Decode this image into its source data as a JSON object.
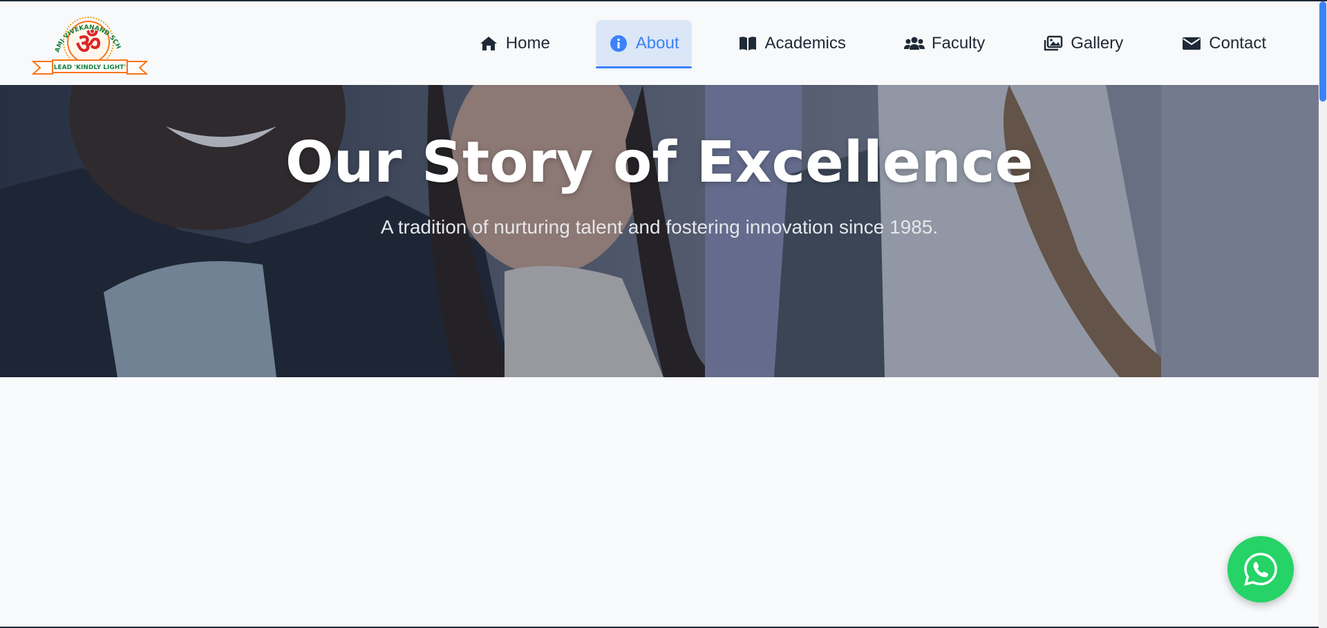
{
  "logo": {
    "school_name": "SWAMI VIVEKANAND SCHOOL",
    "motto": "LEAD 'KINDLY LIGHT'"
  },
  "nav": {
    "items": [
      {
        "label": "Home",
        "icon": "home-icon",
        "active": false
      },
      {
        "label": "About",
        "icon": "info-icon",
        "active": true
      },
      {
        "label": "Academics",
        "icon": "book-icon",
        "active": false
      },
      {
        "label": "Faculty",
        "icon": "users-icon",
        "active": false
      },
      {
        "label": "Gallery",
        "icon": "images-icon",
        "active": false
      },
      {
        "label": "Contact",
        "icon": "envelope-icon",
        "active": false
      }
    ]
  },
  "hero": {
    "title": "Our Story of Excellence",
    "subtitle": "A tradition of nurturing talent and fostering innovation since 1985."
  },
  "colors": {
    "accent": "#3b82f6",
    "active_bg": "#dbe6f7",
    "whatsapp": "#25d366",
    "nav_text": "#1f2937"
  },
  "floating": {
    "whatsapp_icon": "whatsapp-icon"
  }
}
